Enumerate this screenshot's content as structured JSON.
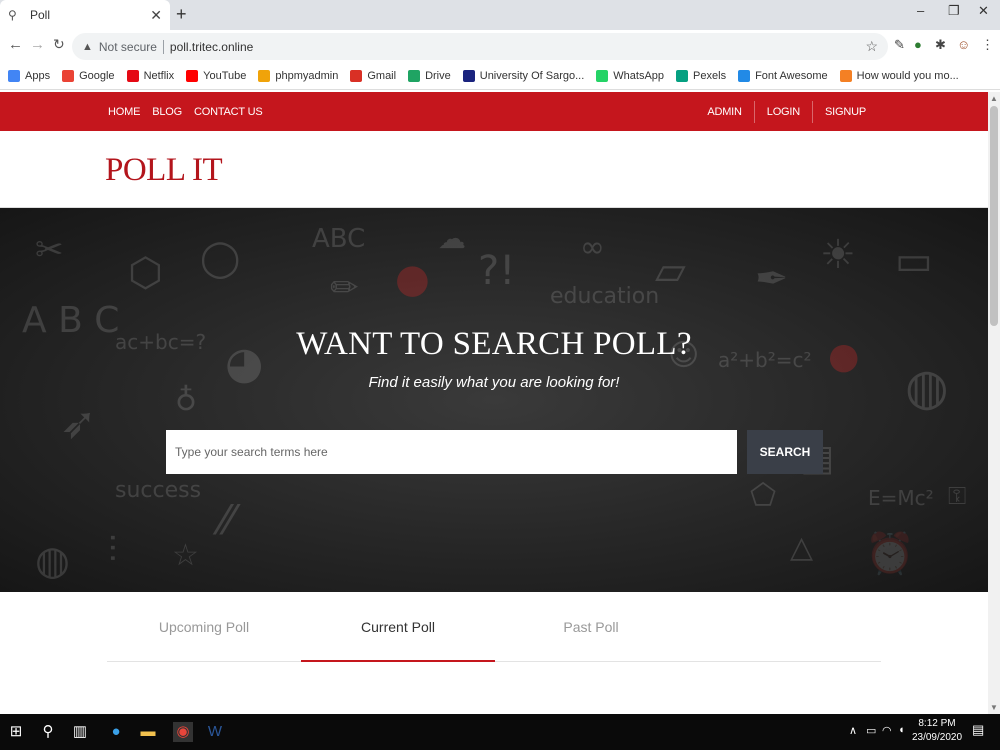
{
  "browser": {
    "tab_title": "Poll",
    "url_warning": "Not secure",
    "url": "poll.tritec.online",
    "bookmarks": [
      {
        "label": "Apps",
        "icon": "apps-grid-icon",
        "color": "#4285f4"
      },
      {
        "label": "Google",
        "icon": "google-icon",
        "color": "#ea4335"
      },
      {
        "label": "Netflix",
        "icon": "netflix-icon",
        "color": "#e50914"
      },
      {
        "label": "YouTube",
        "icon": "youtube-icon",
        "color": "#ff0000"
      },
      {
        "label": "phpmyadmin",
        "icon": "phpmyadmin-icon",
        "color": "#f0a30a"
      },
      {
        "label": "Gmail",
        "icon": "gmail-icon",
        "color": "#d93025"
      },
      {
        "label": "Drive",
        "icon": "drive-icon",
        "color": "#1fa463"
      },
      {
        "label": "University Of Sargo...",
        "icon": "university-icon",
        "color": "#1a237e"
      },
      {
        "label": "WhatsApp",
        "icon": "whatsapp-icon",
        "color": "#25d366"
      },
      {
        "label": "Pexels",
        "icon": "pexels-icon",
        "color": "#05a081"
      },
      {
        "label": "Font Awesome",
        "icon": "font-awesome-icon",
        "color": "#228ae6"
      },
      {
        "label": "How would you mo...",
        "icon": "stackoverflow-icon",
        "color": "#f48024"
      }
    ]
  },
  "nav": {
    "left": [
      "HOME",
      "BLOG",
      "CONTACT US"
    ],
    "right": [
      "ADMIN",
      "LOGIN",
      "SIGNUP"
    ]
  },
  "brand": {
    "logo": "POLL IT"
  },
  "hero": {
    "title": "WANT TO SEARCH POLL?",
    "subtitle": "Find it easily what you are looking for!",
    "search_placeholder": "Type your search terms here",
    "search_button": "SEARCH"
  },
  "poll_tabs": [
    {
      "label": "Upcoming Poll",
      "active": false
    },
    {
      "label": "Current Poll",
      "active": true
    },
    {
      "label": "Past Poll",
      "active": false
    }
  ],
  "taskbar": {
    "time": "8:12 PM",
    "date": "23/09/2020"
  },
  "colors": {
    "accent": "#c5161d",
    "search_button": "#3a3f48"
  }
}
